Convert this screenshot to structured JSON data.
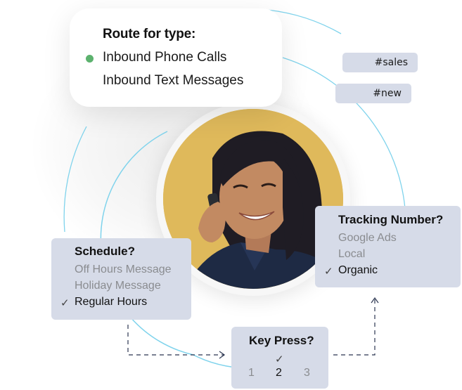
{
  "route_card": {
    "title": "Route for type:",
    "options": [
      {
        "label": "Inbound Phone Calls",
        "selected": true
      },
      {
        "label": "Inbound Text Messages",
        "selected": false
      }
    ],
    "selected_indicator_color": "#5cb26e"
  },
  "tags": [
    {
      "label": "#sales"
    },
    {
      "label": "#new"
    }
  ],
  "schedule": {
    "title": "Schedule?",
    "options": [
      {
        "label": "Off Hours Message",
        "selected": false
      },
      {
        "label": "Holiday Message",
        "selected": false
      },
      {
        "label": "Regular Hours",
        "selected": true
      }
    ],
    "check_glyph": "✓"
  },
  "tracking": {
    "title": "Tracking Number?",
    "options": [
      {
        "label": "Google Ads",
        "selected": false
      },
      {
        "label": "Local",
        "selected": false
      },
      {
        "label": "Organic",
        "selected": true
      }
    ],
    "check_glyph": "✓"
  },
  "key_press": {
    "title": "Key Press?",
    "options": [
      {
        "label": "1",
        "selected": false
      },
      {
        "label": "2",
        "selected": true
      },
      {
        "label": "3",
        "selected": false
      }
    ],
    "check_glyph": "✓"
  },
  "photo": {
    "description": "Smiling woman talking on a phone",
    "background_color": "#dfb95b"
  },
  "colors": {
    "arc": "#7fd3ec",
    "card": "#d6dbe8",
    "connector": "#2b3550"
  }
}
